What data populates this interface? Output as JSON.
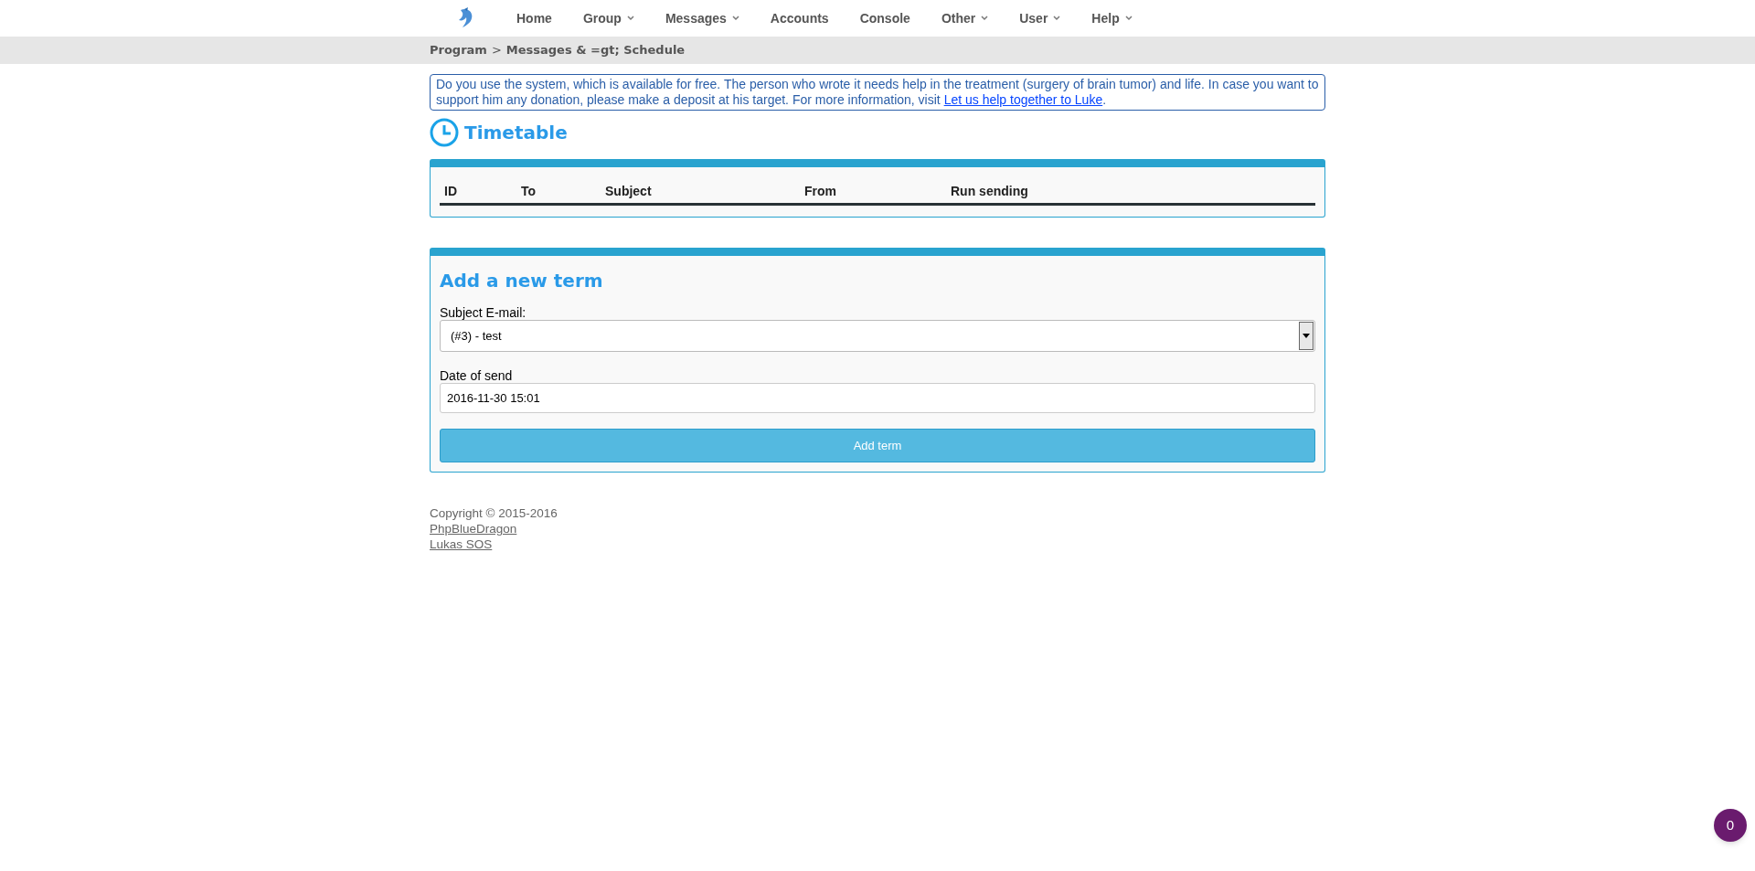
{
  "nav": [
    {
      "label": "Home",
      "dropdown": false
    },
    {
      "label": "Group",
      "dropdown": true
    },
    {
      "label": "Messages",
      "dropdown": true
    },
    {
      "label": "Accounts",
      "dropdown": false
    },
    {
      "label": "Console",
      "dropdown": false
    },
    {
      "label": "Other",
      "dropdown": true
    },
    {
      "label": "User",
      "dropdown": true
    },
    {
      "label": "Help",
      "dropdown": true
    }
  ],
  "breadcrumb": {
    "root": "Program",
    "separator": ">",
    "current": "Messages & =gt; Schedule"
  },
  "notice": {
    "text": "Do you use the system, which is available for free. The person who wrote it needs help in the treatment (surgery of brain tumor) and life. In case you want to support him any donation, please make a deposit at his target. For more information, visit",
    "link": "Let us help together to Luke",
    "end": "."
  },
  "title": "Timetable",
  "table": {
    "columns": [
      "ID",
      "To",
      "Subject",
      "From",
      "Run sending"
    ]
  },
  "form": {
    "title": "Add a new term",
    "subject_label": "Subject E-mail:",
    "subject_value": "(#3) - test",
    "date_label": "Date of send",
    "date_value": "2016-11-30 15:01",
    "button": "Add term"
  },
  "footer": {
    "copyright": "Copyright © 2015-2016",
    "links": [
      "PhpBlueDragon",
      "Lukas SOS"
    ]
  },
  "badge": "0"
}
